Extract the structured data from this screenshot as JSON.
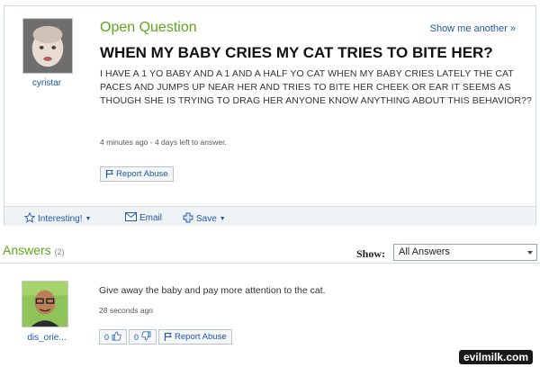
{
  "question": {
    "section_label": "Open Question",
    "show_another": "Show me another »",
    "title": "WHEN MY BABY CRIES MY CAT TRIES TO BITE HER?",
    "body": "I HAVE A 1 YO BABY AND A 1 AND A HALF YO CAT WHEN MY BABY CRIES LATELY THE CAT PACES AND JUMPS UP NEAR HER AND TRIES TO BITE HER CHEEK OR EAR IT SEEMS AS THOUGH SHE IS TRYING TO DRAG HER ANYONE KNOW ANYTHING ABOUT THIS BEHAVIOR??",
    "meta": "4 minutes ago - 4 days left to answer.",
    "asker": "cyristar",
    "report_label": "Report Abuse"
  },
  "toolbar": {
    "interesting_label": "Interesting!",
    "email_label": "Email",
    "save_label": "Save"
  },
  "answers": {
    "heading": "Answers",
    "count": "(2)",
    "show_label": "Show:",
    "filter_selected": "All Answers",
    "items": [
      {
        "text": "Give away the baby and pay more attention to the cat.",
        "meta": "28 seconds ago",
        "user": "dis_orie...",
        "thumbs_up": "0",
        "thumbs_down": "0",
        "report_label": "Report Abuse"
      }
    ]
  },
  "watermark": "evilmilk.com",
  "icons": {
    "star": "star-icon",
    "envelope": "envelope-icon",
    "plus": "plus-icon",
    "flag": "flag-icon",
    "thumbs_up": "thumbs-up-icon",
    "thumbs_down": "thumbs-down-icon"
  },
  "colors": {
    "link": "#1e57a8",
    "accent_green": "#5ba61a",
    "border": "#cfdbe6"
  }
}
